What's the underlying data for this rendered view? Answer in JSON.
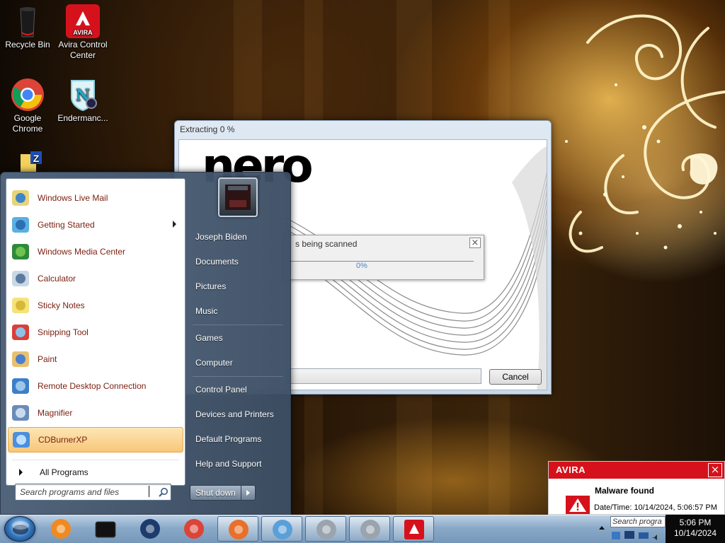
{
  "desktop": {
    "icons": [
      {
        "label": "Recycle Bin"
      },
      {
        "label": "Avira Control Center"
      },
      {
        "label": "Google Chrome"
      },
      {
        "label": "Endermanc..."
      },
      {
        "label": ""
      }
    ]
  },
  "nero_window": {
    "title": "Extracting 0 %",
    "logo": "nero",
    "cancel_label": "Cancel"
  },
  "scan_dialog": {
    "title": "s being scanned",
    "percent": "0%"
  },
  "start_menu": {
    "programs": [
      {
        "label": "Windows Live Mail",
        "icon": "windows-live-mail-icon"
      },
      {
        "label": "Getting Started",
        "icon": "getting-started-icon",
        "submenu": true
      },
      {
        "label": "Windows Media Center",
        "icon": "windows-media-center-icon"
      },
      {
        "label": "Calculator",
        "icon": "calculator-icon"
      },
      {
        "label": "Sticky Notes",
        "icon": "sticky-notes-icon"
      },
      {
        "label": "Snipping Tool",
        "icon": "snipping-tool-icon"
      },
      {
        "label": "Paint",
        "icon": "paint-icon"
      },
      {
        "label": "Remote Desktop Connection",
        "icon": "remote-desktop-icon"
      },
      {
        "label": "Magnifier",
        "icon": "magnifier-icon"
      },
      {
        "label": "CDBurnerXP",
        "icon": "cdburnerxp-icon",
        "highlighted": true
      }
    ],
    "all_programs": "All Programs",
    "search_placeholder": "Search programs and files",
    "right_items": [
      "Joseph Biden",
      "Documents",
      "Pictures",
      "Music",
      "Games",
      "Computer",
      "Control Panel",
      "Devices and Printers",
      "Default Programs",
      "Help and Support"
    ],
    "shutdown_label": "Shut down"
  },
  "avira_popup": {
    "brand": "AVIRA",
    "heading": "Malware found",
    "date_label": "Date/Time: 10/14/2024, 5:06:57 PM",
    "brand_color": "#d5121c"
  },
  "taskbar": {
    "buttons": [
      "windows-media-player-icon",
      "black-app-icon",
      "globe-icon",
      "chrome-icon",
      "firefox-icon",
      "users-icon",
      "installer-icon",
      "installer-icon-2",
      "avira-icon"
    ],
    "tray_search": "Search progra",
    "time": "5:06 PM",
    "date": "10/14/2024"
  }
}
